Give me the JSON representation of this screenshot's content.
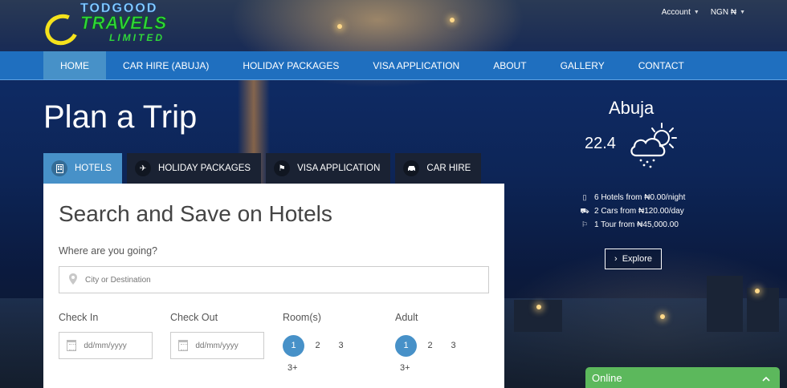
{
  "brand": {
    "line1": "TODGOOD",
    "line2": "TRAVELS",
    "line3": "LIMITED"
  },
  "top_links": {
    "account": "Account",
    "currency": "NGN ₦"
  },
  "nav": [
    "HOME",
    "CAR HIRE (ABUJA)",
    "HOLIDAY PACKAGES",
    "VISA APPLICATION",
    "ABOUT",
    "GALLERY",
    "CONTACT"
  ],
  "hero": {
    "title": "Plan a Trip"
  },
  "tabs": [
    {
      "label": "HOTELS",
      "icon": "hotel-icon"
    },
    {
      "label": "HOLIDAY PACKAGES",
      "icon": "plane-icon"
    },
    {
      "label": "VISA APPLICATION",
      "icon": "flag-icon"
    },
    {
      "label": "CAR HIRE",
      "icon": "car-icon"
    }
  ],
  "search": {
    "heading": "Search and Save on Hotels",
    "question": "Where are you going?",
    "destination_placeholder": "City or Destination",
    "checkin_label": "Check In",
    "checkout_label": "Check Out",
    "date_placeholder": "dd/mm/yyyy",
    "rooms_label": "Room(s)",
    "adult_label": "Adult",
    "options": [
      "1",
      "2",
      "3"
    ],
    "more": "3+"
  },
  "weather": {
    "city": "Abuja",
    "temp": "22.4",
    "icon": "cloud-sun-rain-icon",
    "stats": [
      {
        "icon": "building-icon",
        "text": "6 Hotels from ₦0.00/night"
      },
      {
        "icon": "car-icon",
        "text": "2 Cars from ₦120.00/day"
      },
      {
        "icon": "flag-icon",
        "text": "1 Tour from ₦45,000.00"
      }
    ],
    "explore": "Explore"
  },
  "chat": {
    "label": "Online"
  },
  "colors": {
    "nav": "#1f6fbf",
    "active": "#4791c8",
    "online": "#5cb85c"
  }
}
